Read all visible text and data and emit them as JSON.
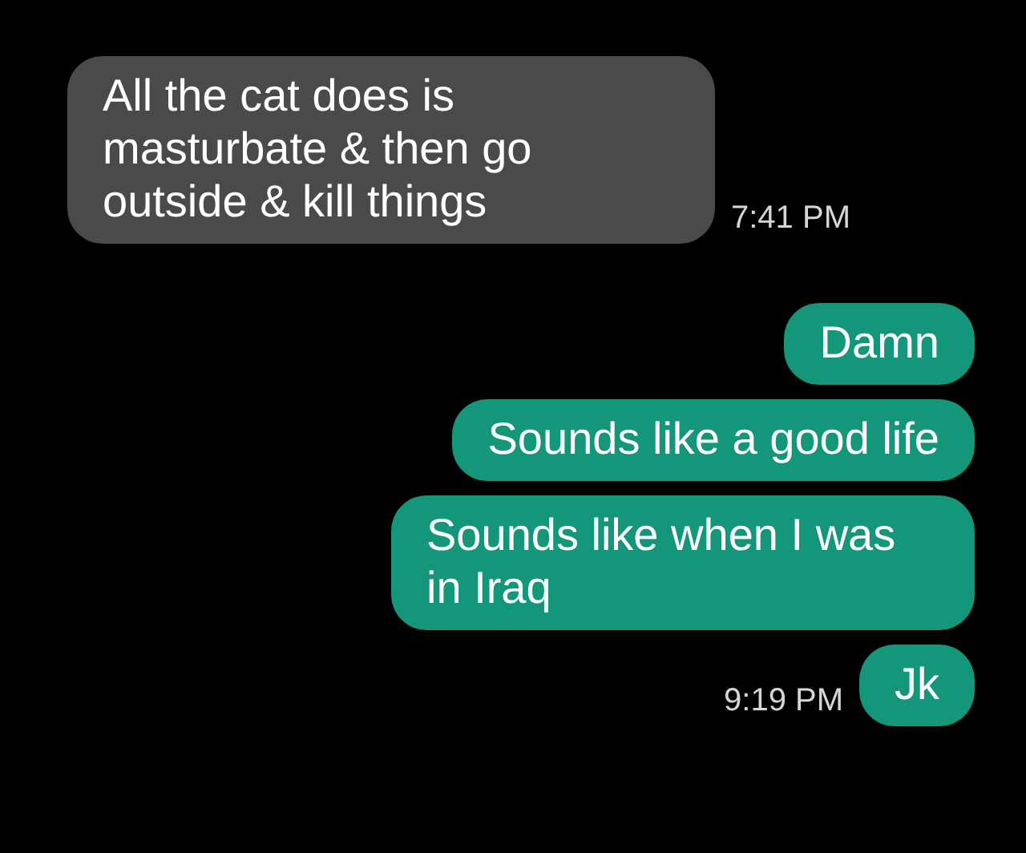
{
  "messages": [
    {
      "kind": "incoming",
      "text": "All the cat does is masturbate & then go outside & kill things",
      "time": "7:41 PM"
    },
    {
      "kind": "outgoing",
      "text": "Damn"
    },
    {
      "kind": "outgoing",
      "text": "Sounds like a good life"
    },
    {
      "kind": "outgoing",
      "text": "Sounds like when I was in Iraq"
    },
    {
      "kind": "outgoing",
      "text": "Jk",
      "time": "9:19 PM"
    }
  ]
}
